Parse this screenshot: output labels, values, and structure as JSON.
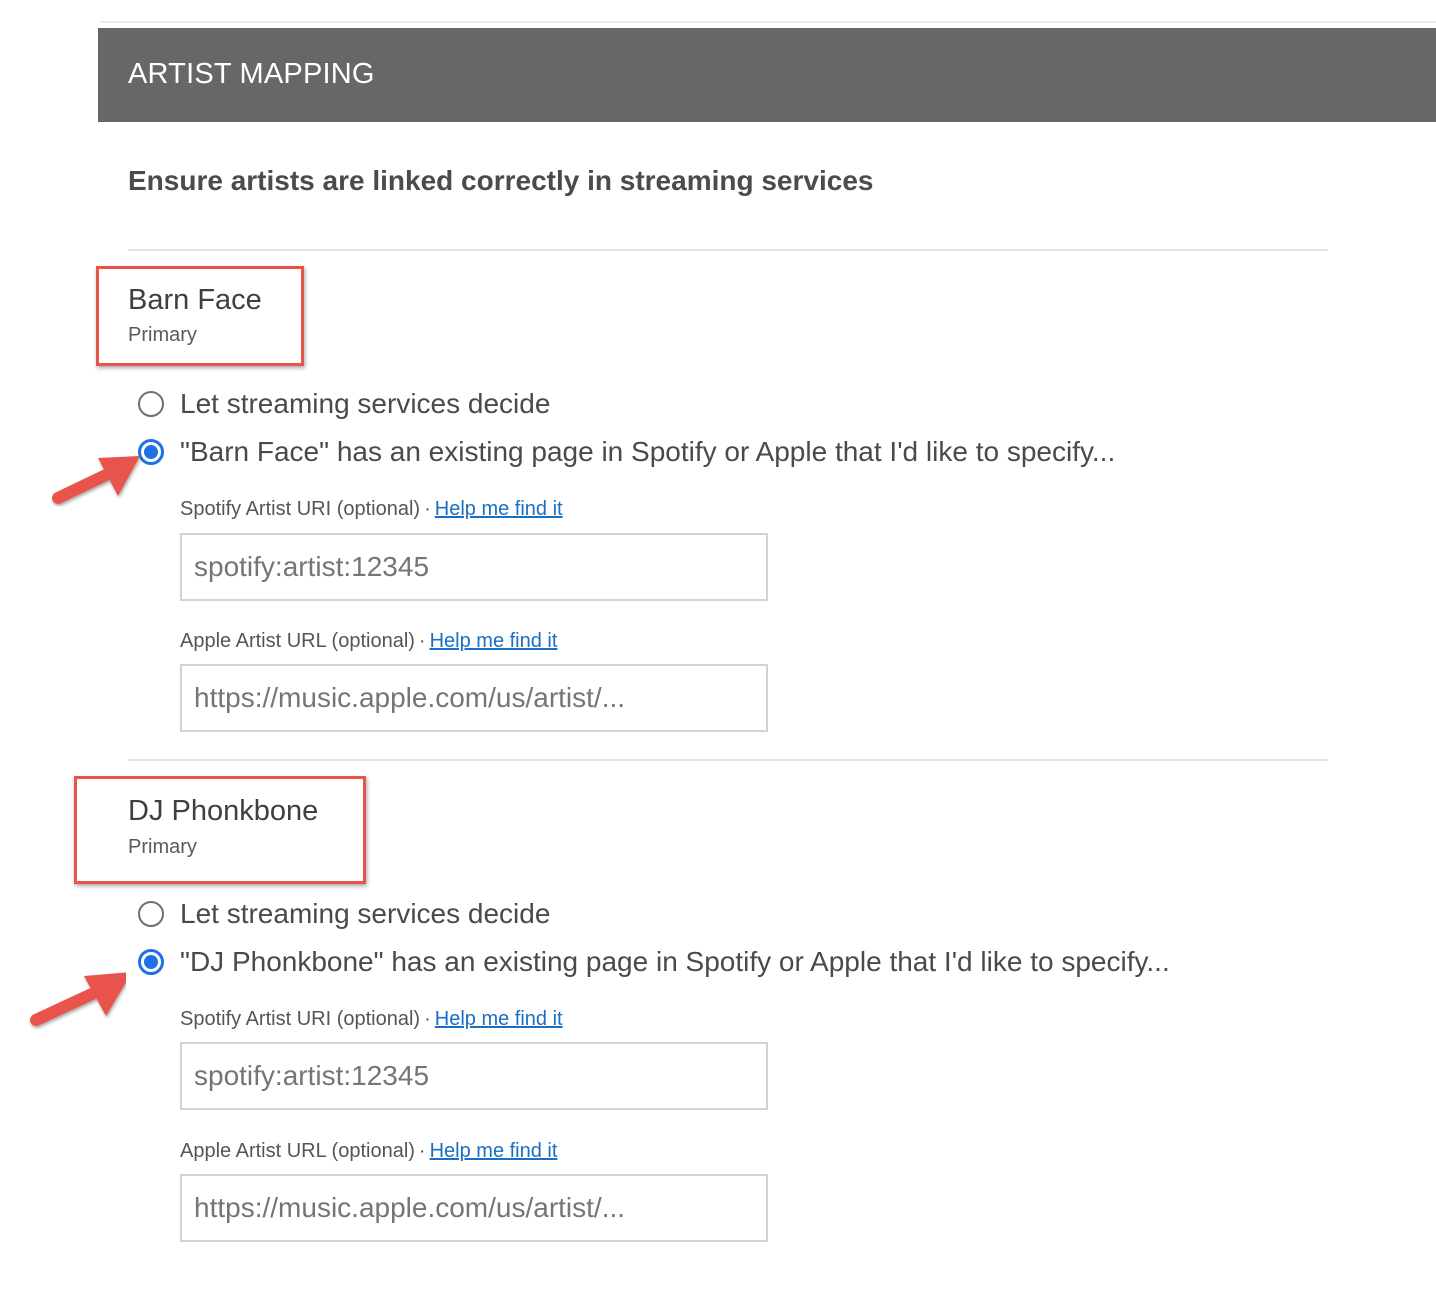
{
  "header": {
    "title": "ARTIST MAPPING"
  },
  "subtitle": "Ensure artists are linked correctly in streaming services",
  "colors": {
    "header_bg": "#676767",
    "highlight_red": "#e8534c",
    "radio_blue": "#1f6fe5",
    "link_blue": "#1a6fc4"
  },
  "artists": [
    {
      "name": "Barn Face",
      "role": "Primary",
      "option_decide": "Let streaming services decide",
      "option_specify": "\"Barn Face\" has an existing page in Spotify or Apple that I'd like to specify...",
      "selected_option": "specify",
      "spotify_label": "Spotify Artist URI (optional)",
      "spotify_help": "Help me find it",
      "spotify_placeholder": "spotify:artist:12345",
      "apple_label": "Apple Artist URL (optional)",
      "apple_help": "Help me find it",
      "apple_placeholder": "https://music.apple.com/us/artist/..."
    },
    {
      "name": "DJ Phonkbone",
      "role": "Primary",
      "option_decide": "Let streaming services decide",
      "option_specify": "\"DJ Phonkbone\" has an existing page in Spotify or Apple that I'd like to specify...",
      "selected_option": "specify",
      "spotify_label": "Spotify Artist URI (optional)",
      "spotify_help": "Help me find it",
      "spotify_placeholder": "spotify:artist:12345",
      "apple_label": "Apple Artist URL (optional)",
      "apple_help": "Help me find it",
      "apple_placeholder": "https://music.apple.com/us/artist/..."
    }
  ],
  "annotations": {
    "highlight_boxes": [
      "artist-name-block",
      "artist-name-block"
    ],
    "arrows": [
      "arrow-icon",
      "arrow-icon"
    ]
  }
}
